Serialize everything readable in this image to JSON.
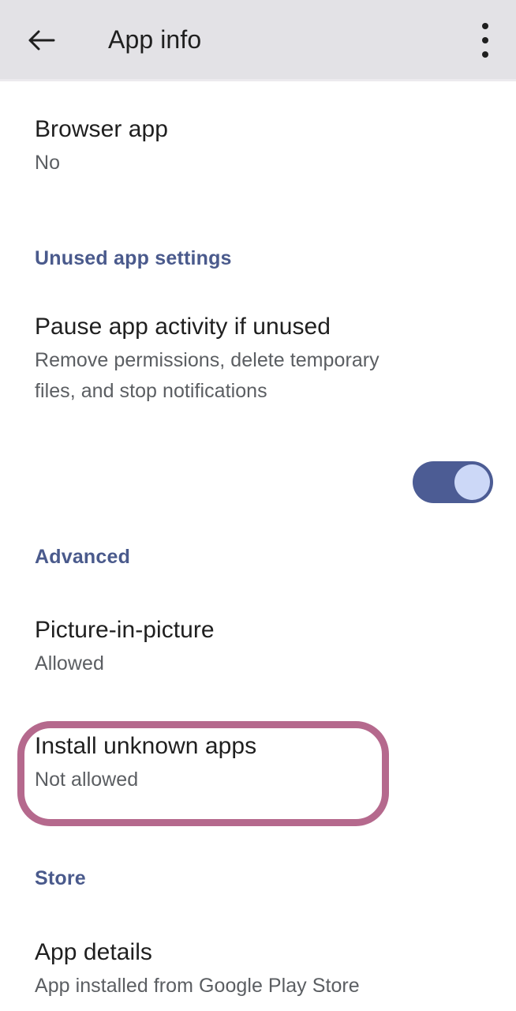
{
  "appbar": {
    "title": "App info",
    "back_icon": "arrow-left-icon",
    "overflow_icon": "more-vertical-icon"
  },
  "sections": [
    {
      "header": null,
      "items": [
        {
          "title": "Browser app",
          "summary": "No"
        }
      ]
    },
    {
      "header": "Unused app settings",
      "items": [
        {
          "title": "Pause app activity if unused",
          "summary": "Remove permissions, delete temporary files, and stop notifications",
          "toggle": "on"
        }
      ]
    },
    {
      "header": "Advanced",
      "items": [
        {
          "title": "Picture-in-picture",
          "summary": "Allowed"
        },
        {
          "title": "Install unknown apps",
          "summary": "Not allowed",
          "highlighted": true
        }
      ]
    },
    {
      "header": "Store",
      "items": [
        {
          "title": "App details",
          "summary": "App installed from Google Play Store"
        }
      ]
    }
  ],
  "colors": {
    "appbar_background": "#e3e2e6",
    "section_header": "#4a5a8c",
    "title_text": "#1f1f1f",
    "summary_text": "#5b5e62",
    "toggle_track_on": "#4c5c94",
    "toggle_thumb_on": "#ccd8f7",
    "highlight_border": "#b5698d",
    "page_background": "#ffffff"
  }
}
